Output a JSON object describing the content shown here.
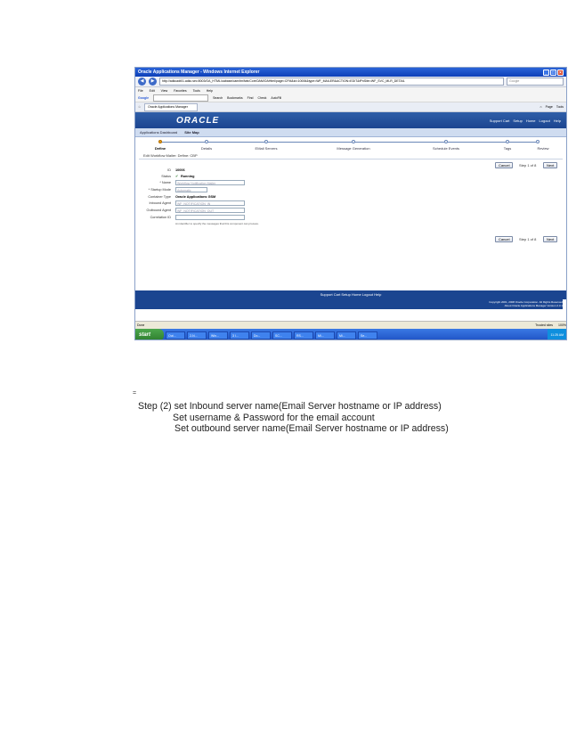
{
  "screenshot": {
    "window_title": "Oracle Applications Manager - Windows Internet Explorer",
    "address_url": "http://adkcadt01.adkc.sec:8003/OA_HTML/oabase/oam/tm/fwk/CoreOAM/OAHtml/page=CFM&id=10006&type=WF_MAILER&ACTION=EDIT&fPnSite=WF_SVC_MLR_DETAIL",
    "search_placeholder": "Google",
    "menu": [
      "File",
      "Edit",
      "View",
      "Favorites",
      "Tools",
      "Help"
    ],
    "google_label": "Google",
    "google_tools": [
      "Search",
      "Bookmarks",
      "Find",
      "Check",
      "AutoFill"
    ],
    "tab_label": "Oracle Applications Manager",
    "tab_tools": [
      "Page",
      "Tools"
    ],
    "oracle_logo": "ORACLE",
    "banner_links": [
      "Support Cart",
      "Setup",
      "Home",
      "Logout",
      "Help"
    ],
    "breadcrumbs": [
      "Applications Dashboard",
      "Site Map"
    ],
    "train_steps": [
      "Define",
      "Details",
      "EMail Servers",
      "Message Generation",
      "Schedule Events",
      "Tags",
      "Review"
    ],
    "page_title": "Edit Workflow Mailer: Define: CBP",
    "cancel_label": "Cancel",
    "step_text": "Step 1 of 8",
    "next_label": "Next",
    "form": {
      "id_label": "ID",
      "id_value": "10006",
      "status_label": "Status",
      "status_value": "Running",
      "name_label": "* Name",
      "name_value": "Workflow Notification Mailer",
      "startup_label": "* Startup Mode",
      "startup_value": "Automatic",
      "container_label": "Container Type",
      "container_value": "Oracle Applications GSM",
      "inbound_label": "Inbound Agent",
      "inbound_value": "WF_NOTIFICATION_IN",
      "outbound_label": "Outbound Agent",
      "outbound_value": "WF_NOTIFICATION_OUT",
      "correlation_label": "Correlation ID",
      "correlation_hint": "An identifier to specify the messages that this component can process."
    },
    "footer_links": "Support Cart   Setup   Home   Logout   Help",
    "copyright": "Copyright 2001, 2008 Oracle Corporation. All Rights Reserved",
    "about": "About Oracle Applications Manager Version 2.3.1",
    "status_done": "Done",
    "status_zone": "Trusted sites",
    "status_zoom": "100%",
    "start_label": "start",
    "tasks": [
      "Out...",
      "2-N...",
      "Win...",
      "3 I...",
      "Do...",
      "SC...",
      "RS...",
      "Mi...",
      "Mi...",
      "Se..."
    ],
    "tray_time": "11:25 AM"
  },
  "marker": "=",
  "instructions": [
    "Step (2) set Inbound server name(Email Server hostname or IP address)",
    "Set username & Password for the email account",
    "Set outbound server name(Email Server hostname or IP address)"
  ]
}
